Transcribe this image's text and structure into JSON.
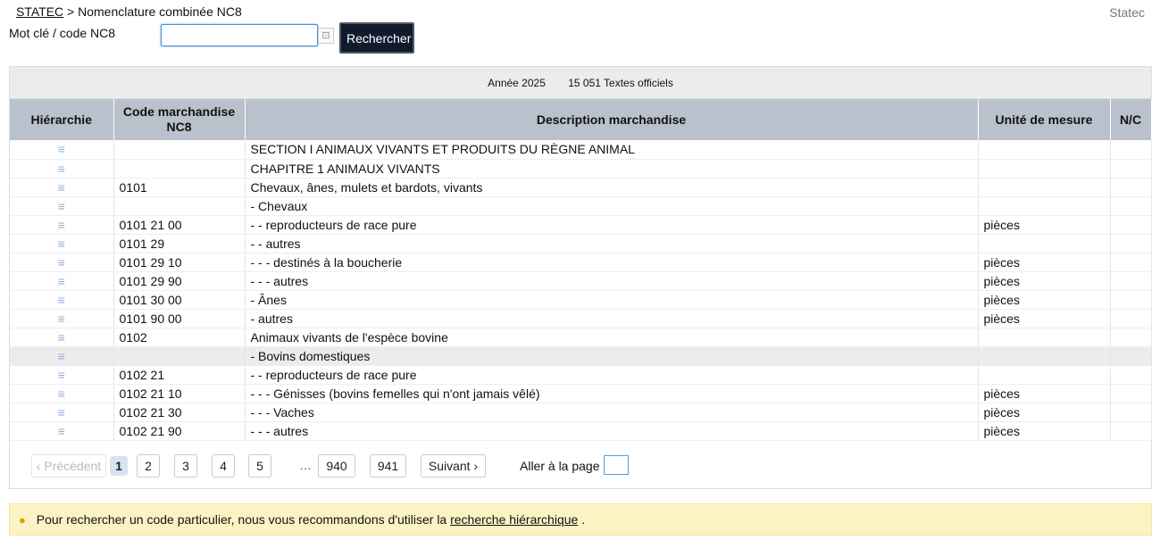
{
  "breadcrumb": {
    "root": "STATEC",
    "separator": ">",
    "current": "Nomenclature combinée NC8"
  },
  "brand": "Statec",
  "search": {
    "label": "Mot clé / code NC8",
    "value": "",
    "button": "Rechercher"
  },
  "summary": {
    "year": "Année 2025",
    "count": "15 051 Textes officiels"
  },
  "table": {
    "headers": [
      "Hiérarchie",
      "Code marchandise NC8",
      "Description marchandise",
      "Unité de mesure",
      "N/C"
    ],
    "rows": [
      {
        "code": "",
        "desc": "SECTION I ANIMAUX VIVANTS ET PRODUITS DU RÈGNE ANIMAL",
        "unit": "",
        "nc": ""
      },
      {
        "code": "",
        "desc": "CHAPITRE 1 ANIMAUX VIVANTS",
        "unit": "",
        "nc": ""
      },
      {
        "code": "0101",
        "desc": "Chevaux, ânes, mulets et bardots, vivants",
        "unit": "",
        "nc": ""
      },
      {
        "code": "",
        "desc": "- Chevaux",
        "unit": "",
        "nc": ""
      },
      {
        "code": "0101 21 00",
        "desc": "- - reproducteurs de race pure",
        "unit": "pièces",
        "nc": ""
      },
      {
        "code": "0101 29",
        "desc": "- - autres",
        "unit": "",
        "nc": ""
      },
      {
        "code": "0101 29 10",
        "desc": "- - - destinés à la boucherie",
        "unit": "pièces",
        "nc": ""
      },
      {
        "code": "0101 29 90",
        "desc": "- - - autres",
        "unit": "pièces",
        "nc": ""
      },
      {
        "code": "0101 30 00",
        "desc": "- Ânes",
        "unit": "pièces",
        "nc": ""
      },
      {
        "code": "0101 90 00",
        "desc": "- autres",
        "unit": "pièces",
        "nc": ""
      },
      {
        "code": "0102",
        "desc": "Animaux vivants de l'espèce bovine",
        "unit": "",
        "nc": ""
      },
      {
        "code": "",
        "desc": "- Bovins domestiques",
        "unit": "",
        "nc": "",
        "hovered": true
      },
      {
        "code": "0102 21",
        "desc": "- - reproducteurs de race pure",
        "unit": "",
        "nc": ""
      },
      {
        "code": "0102 21 10",
        "desc": "- - - Génisses (bovins femelles qui n'ont jamais vêlé)",
        "unit": "pièces",
        "nc": ""
      },
      {
        "code": "0102 21 30",
        "desc": "- - - Vaches",
        "unit": "pièces",
        "nc": ""
      },
      {
        "code": "0102 21 90",
        "desc": "- - - autres",
        "unit": "pièces",
        "nc": ""
      }
    ]
  },
  "pagination": {
    "prev": "‹ Précédent",
    "pages": [
      "1",
      "2",
      "3",
      "4",
      "5"
    ],
    "current": "1",
    "ellipsis": "…",
    "last_pages": [
      "940",
      "941"
    ],
    "next": "Suivant ›",
    "goto_label": "Aller à la page"
  },
  "notice": {
    "text": "Pour rechercher un code particulier, nous vous recommandons d'utiliser la",
    "link": "recherche hiérarchique",
    "end": "."
  },
  "icons": {
    "hierarchy": "hierarchy-tree-icon",
    "clear": "clear-input-icon",
    "notice": "lightbulb-icon"
  }
}
